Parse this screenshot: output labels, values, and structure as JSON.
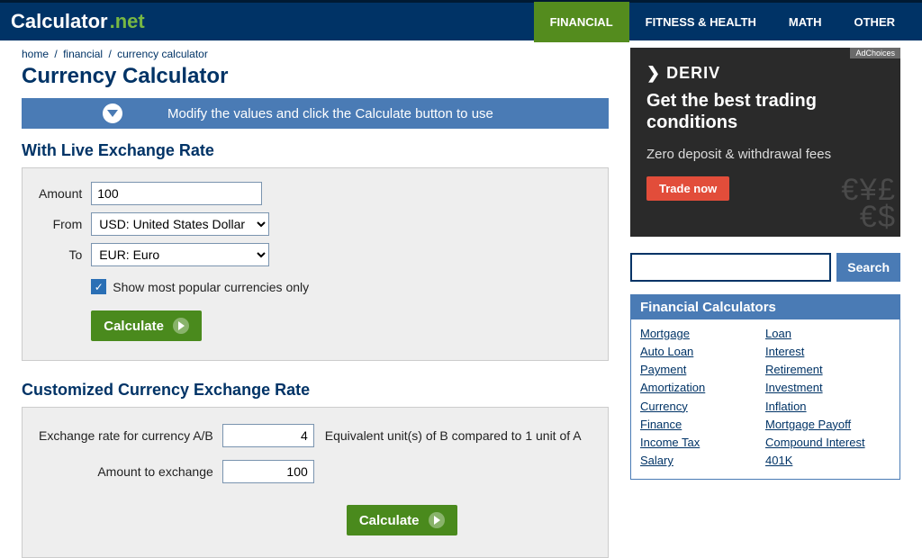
{
  "logo": {
    "name": "Calculator",
    "suffix": ".net"
  },
  "nav": {
    "items": [
      "FINANCIAL",
      "FITNESS & HEALTH",
      "MATH",
      "OTHER"
    ],
    "active_index": 0
  },
  "breadcrumb": {
    "items": [
      "home",
      "financial",
      "currency calculator"
    ]
  },
  "page_title": "Currency Calculator",
  "instruction": "Modify the values and click the Calculate button to use",
  "live": {
    "heading": "With Live Exchange Rate",
    "amount_label": "Amount",
    "amount_value": "100",
    "from_label": "From",
    "from_value": "USD: United States Dollar",
    "to_label": "To",
    "to_value": "EUR: Euro",
    "popular_label": "Show most popular currencies only",
    "calculate": "Calculate"
  },
  "custom": {
    "heading": "Customized Currency Exchange Rate",
    "rate_label": "Exchange rate for currency A/B",
    "rate_value": "4",
    "rate_note": "Equivalent unit(s) of B compared to 1 unit of A",
    "amount_label": "Amount to exchange",
    "amount_value": "100",
    "calculate": "Calculate"
  },
  "ad": {
    "adchoices": "AdChoices",
    "brand": "DERIV",
    "headline": "Get the best trading conditions",
    "sub": "Zero deposit & withdrawal fees",
    "cta": "Trade now"
  },
  "search": {
    "button": "Search"
  },
  "sidebox": {
    "header": "Financial Calculators",
    "col1": [
      "Mortgage",
      "Auto Loan",
      "Payment",
      "Amortization",
      "Currency",
      "Finance",
      "Income Tax",
      "Salary"
    ],
    "col2": [
      "Loan",
      "Interest",
      "Retirement",
      "Investment",
      "Inflation",
      "Mortgage Payoff",
      "Compound Interest",
      "401K"
    ]
  }
}
